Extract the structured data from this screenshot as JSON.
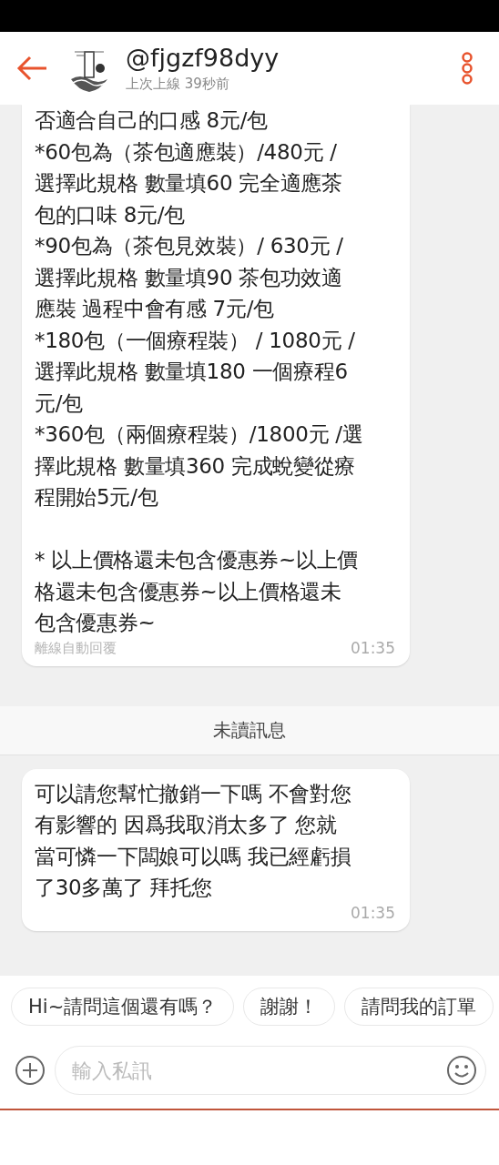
{
  "header": {
    "title": "@fjgzf98dyy",
    "subtitle": "上次上線 39秒前"
  },
  "messages": [
    {
      "paragraphs": [
        [
          "否適合自己的口感 8元/包",
          "*60包為（茶包適應裝）/480元 /",
          "選擇此規格  數量填60  完全適應茶",
          "包的口味  8元/包",
          "*90包為（茶包見效裝）/ 630元 /",
          "選擇此規格 數量填90 茶包功效適",
          "應裝 過程中會有感 7元/包",
          "*180包（一個療程裝） / 1080元 /",
          "選擇此規格  數量填180 一個療程6",
          "元/包",
          "*360包（兩個療程裝）/1800元 /選",
          "擇此規格  數量填360 完成蛻變從療",
          "程開始5元/包"
        ],
        [
          "* 以上價格還未包含優惠券~以上價",
          "格還未包含優惠券~以上價格還未",
          "包含優惠券~"
        ]
      ],
      "note": "離線自動回覆",
      "time": "01:35"
    },
    {
      "divider": "未讀訊息"
    },
    {
      "paragraphs": [
        [
          "可以請您幫忙撤銷一下嗎 不會對您",
          "有影響的  因爲我取消太多了 您就",
          "當可憐一下闆娘可以嗎 我已經虧損",
          "了30多萬了 拜托您"
        ]
      ],
      "time": "01:35"
    }
  ],
  "quick_replies": [
    "Hi~請問這個還有嗎？",
    "謝謝！",
    "請問我的訂單"
  ],
  "input": {
    "placeholder": "輸入私訊"
  }
}
